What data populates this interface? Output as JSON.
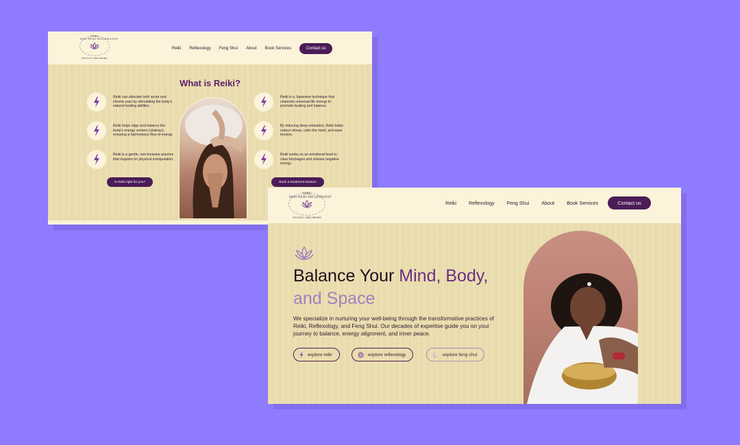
{
  "brand": {
    "ring_text": "FENG SHUI·REIKI·REFLEXOLOGY",
    "tagline": "HOLISTIC WELLBEING"
  },
  "nav": {
    "items": [
      "Reiki",
      "Reflexology",
      "Feng Shui",
      "About",
      "Book Services"
    ],
    "cta": "Contact us"
  },
  "reiki_page": {
    "title": "What is Reiki?",
    "features_left": [
      "Reiki can alleviate both acute and chronic pain by stimulating the body's natural healing abilities.",
      "Reiki helps align and balance the body's energy centers (chakras), ensuring a harmonious flow of energy.",
      "Reiki is a gentle, non-invasive practice that requires no physical manipulation."
    ],
    "features_right": [
      "Reiki is a Japanese technique that channels universal life energy to promote healing and balance.",
      "By inducing deep relaxation, Reiki helps reduce stress, calm the mind, and ease tension.",
      "Reiki works on an emotional level to clear blockages and release negative energy."
    ],
    "btn_left": "Is Reiki right for you?",
    "btn_right": "Book a treatment session"
  },
  "home_page": {
    "title_part1": "Balance Your ",
    "title_part2": "Mind, Body,",
    "title_part3": "and Space",
    "description": "We specialize in nurturing your well-being through the transformative practices of Reiki, Reflexology, and Feng Shui. Our decades of expertise guide you on your journey to balance, energy alignment, and inner peace.",
    "pills": [
      "explore reiki",
      "explore reflexology",
      "explore feng shui"
    ]
  },
  "colors": {
    "background": "#8e7bff",
    "cream": "#fbf3da",
    "wood": "#ecdfb0",
    "plum": "#4b1c57",
    "purple_accent": "#6b2f86",
    "lavender_accent": "#a57fc2",
    "bolt": "#7b3aa6"
  },
  "icons": [
    "lotus-icon",
    "lightning-bolt-icon",
    "spiral-icon",
    "moon-icon"
  ]
}
